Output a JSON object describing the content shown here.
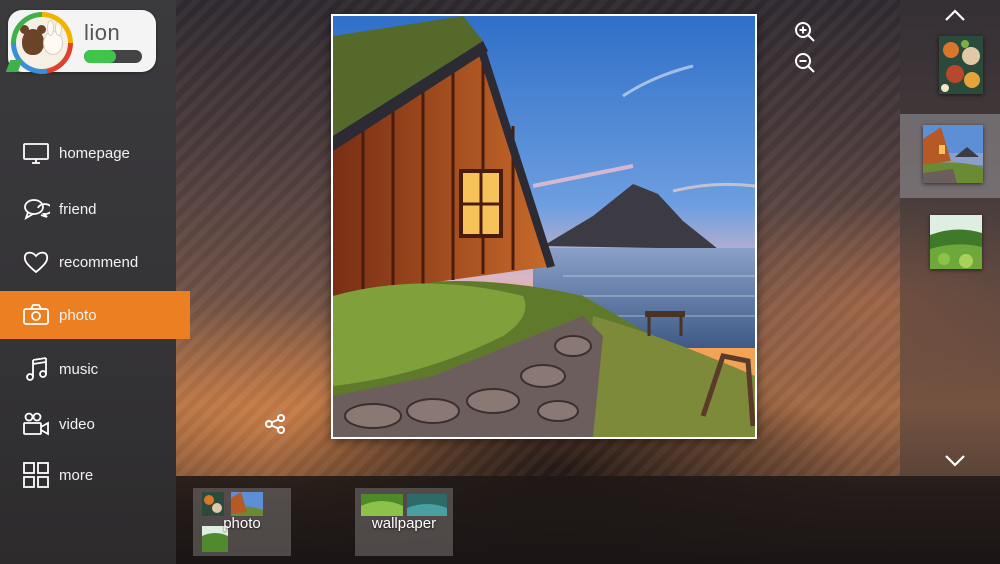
{
  "profile": {
    "username": "lion",
    "level_progress": 0.55,
    "level_color": "#3fc64a"
  },
  "nav": {
    "items": [
      {
        "label": "homepage",
        "icon": "monitor-icon"
      },
      {
        "label": "friend",
        "icon": "chat-bubbles-icon"
      },
      {
        "label": "recommend",
        "icon": "heart-icon"
      },
      {
        "label": "photo",
        "icon": "camera-icon",
        "active": true
      },
      {
        "label": "music",
        "icon": "music-note-icon"
      },
      {
        "label": "video",
        "icon": "video-camera-icon"
      },
      {
        "label": "more",
        "icon": "grid-icon"
      }
    ],
    "active_color": "#ec7f22"
  },
  "viewer": {
    "zoom_in": "zoom-in-icon",
    "zoom_out": "zoom-out-icon",
    "share": "share-icon"
  },
  "thumbnail_rail": {
    "up": "chevron-up-icon",
    "down": "chevron-down-icon",
    "items": [
      "animals-collage",
      "turf-house-sunset",
      "green-hills"
    ],
    "selected_index": 1
  },
  "albums": [
    {
      "label": "photo"
    },
    {
      "label": "wallpaper"
    }
  ]
}
